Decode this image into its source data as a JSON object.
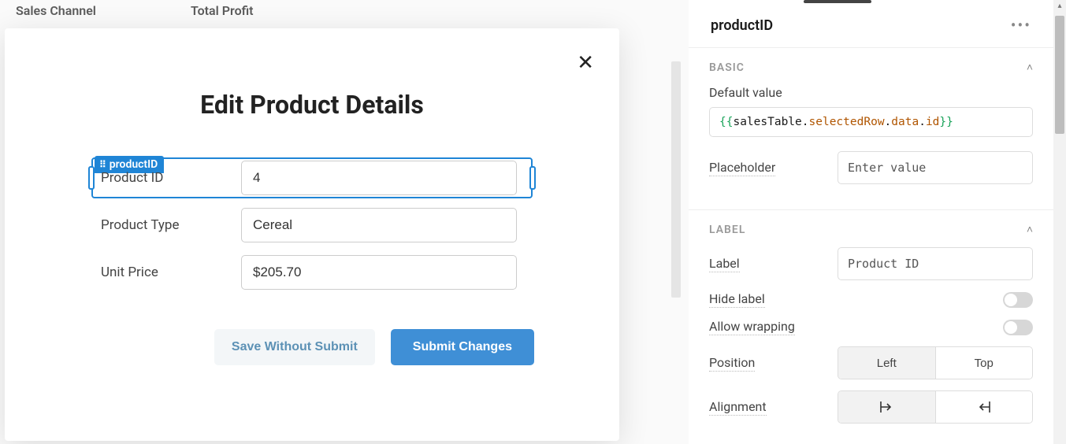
{
  "table": {
    "headers": [
      "Sales Channel",
      "Total Profit"
    ]
  },
  "modal": {
    "title": "Edit Product Details",
    "componentTag": "productID",
    "fields": [
      {
        "label": "Product ID",
        "value": "4"
      },
      {
        "label": "Product Type",
        "value": "Cereal"
      },
      {
        "label": "Unit Price",
        "value": "$205.70"
      }
    ],
    "buttons": {
      "secondary": "Save Without Submit",
      "primary": "Submit Changes"
    }
  },
  "panel": {
    "title": "productID",
    "sections": {
      "basic": {
        "title": "BASIC",
        "defaultValueLabel": "Default value",
        "defaultValueExpr": {
          "open": "{{",
          "o1": "salesTable",
          "p1": "selectedRow",
          "p2": "data",
          "p3": "id",
          "close": "}}"
        },
        "placeholderLabel": "Placeholder",
        "placeholderValue": "Enter value"
      },
      "label": {
        "title": "LABEL",
        "labelLabel": "Label",
        "labelValue": "Product ID",
        "hideLabel": "Hide label",
        "allowWrapping": "Allow wrapping",
        "positionLabel": "Position",
        "positionOptions": [
          "Left",
          "Top"
        ],
        "alignmentLabel": "Alignment"
      }
    }
  }
}
